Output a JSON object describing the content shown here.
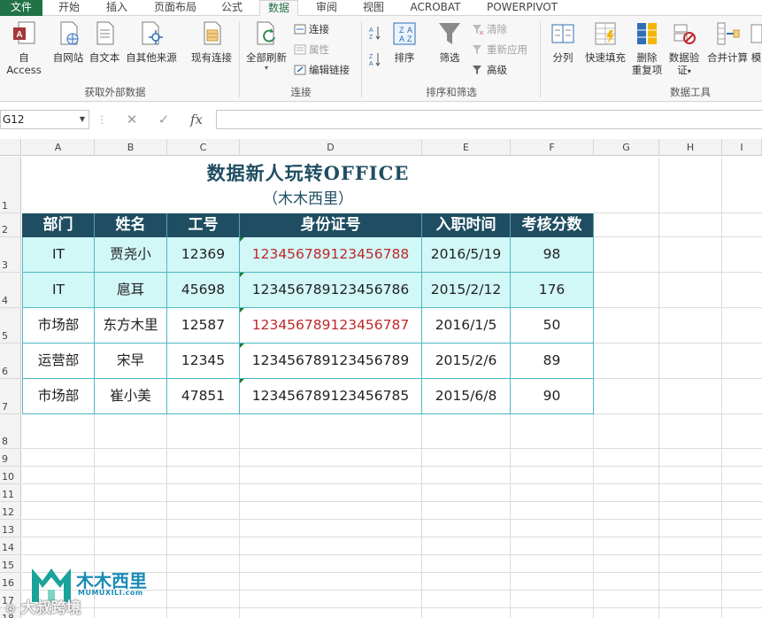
{
  "tabs": [
    "文件",
    "开始",
    "插入",
    "页面布局",
    "公式",
    "数据",
    "审阅",
    "视图",
    "ACROBAT",
    "POWERPIVOT"
  ],
  "active_tab": "数据",
  "ribbon": {
    "get_external": {
      "access": "自 Access",
      "web": "自网站",
      "text": "自文本",
      "other": "自其他来源",
      "existing": "现有连接",
      "group_label": "获取外部数据"
    },
    "connections": {
      "refresh_all": "全部刷新",
      "connections": "连接",
      "properties": "属性",
      "edit_links": "编辑链接",
      "group_label": "连接"
    },
    "sort_filter": {
      "sort": "排序",
      "filter": "筛选",
      "clear": "清除",
      "reapply": "重新应用",
      "advanced": "高级",
      "group_label": "排序和筛选"
    },
    "data_tools": {
      "split": "分列",
      "flash_fill": "快速填充",
      "remove_dup_1": "删除",
      "remove_dup_2": "重复项",
      "validation_1": "数据验",
      "validation_2": "证",
      "consolidate": "合并计算",
      "more": "模",
      "group_label": "数据工具"
    }
  },
  "formula_bar": {
    "name_box": "G12",
    "cancel": "✕",
    "enter": "✓",
    "fx": "fx",
    "value": ""
  },
  "columns": [
    "A",
    "B",
    "C",
    "D",
    "E",
    "F",
    "G",
    "H",
    "I"
  ],
  "rows": [
    "1",
    "2",
    "3",
    "4",
    "5",
    "6",
    "7",
    "8",
    "9",
    "10",
    "11",
    "12",
    "13",
    "14",
    "15",
    "16",
    "17",
    "18"
  ],
  "sheet": {
    "title": "数据新人玩转OFFICE",
    "subtitle": "（木木西里）",
    "headers": [
      "部门",
      "姓名",
      "工号",
      "身份证号",
      "入职时间",
      "考核分数"
    ],
    "records": [
      {
        "dept": "IT",
        "name": "贾尧小",
        "id": "12369",
        "idcard": "123456789123456788",
        "date": "2016/5/19",
        "score": "98",
        "idcard_red": true
      },
      {
        "dept": "IT",
        "name": "扈耳",
        "id": "45698",
        "idcard": "123456789123456786",
        "date": "2015/2/12",
        "score": "176",
        "idcard_red": false
      },
      {
        "dept": "市场部",
        "name": "东方木里",
        "id": "12587",
        "idcard": "123456789123456787",
        "date": "2016/1/5",
        "score": "50",
        "idcard_red": true
      },
      {
        "dept": "运营部",
        "name": "宋早",
        "id": "12345",
        "idcard": "123456789123456789",
        "date": "2015/2/6",
        "score": "89",
        "idcard_red": false
      },
      {
        "dept": "市场部",
        "name": "崔小美",
        "id": "47851",
        "idcard": "123456789123456785",
        "date": "2015/6/8",
        "score": "90",
        "idcard_red": false
      }
    ]
  },
  "watermark": {
    "brand": "木木西里",
    "url": "MUMUXILI.com",
    "overlay": "大叔跨境"
  },
  "colors": {
    "excel_green": "#217346",
    "header_fill": "#1f4e62",
    "row_tint": "#d2f7f7",
    "border_teal": "#4fb8c2",
    "red_text": "#c0282a"
  }
}
